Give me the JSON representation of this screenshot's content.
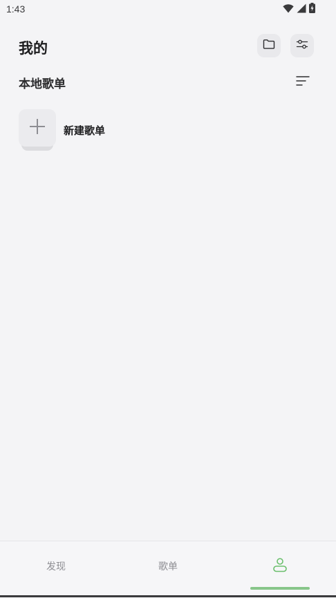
{
  "status_bar": {
    "time": "1:43",
    "icons": [
      "wifi-icon",
      "cellular-signal-icon",
      "battery-charging-icon"
    ]
  },
  "header": {
    "title": "我的",
    "actions": [
      "folder-icon",
      "sliders-icon"
    ]
  },
  "section": {
    "title": "本地歌单",
    "sort_icon": "sort-lines-icon"
  },
  "new_playlist": {
    "label": "新建歌单",
    "icon": "plus-icon"
  },
  "bottom_nav": {
    "tabs": [
      {
        "label": "发现",
        "active": false
      },
      {
        "label": "歌单",
        "active": false
      },
      {
        "label": "",
        "icon": "user-icon",
        "active": true
      }
    ],
    "accent_color": "#88c68a"
  }
}
